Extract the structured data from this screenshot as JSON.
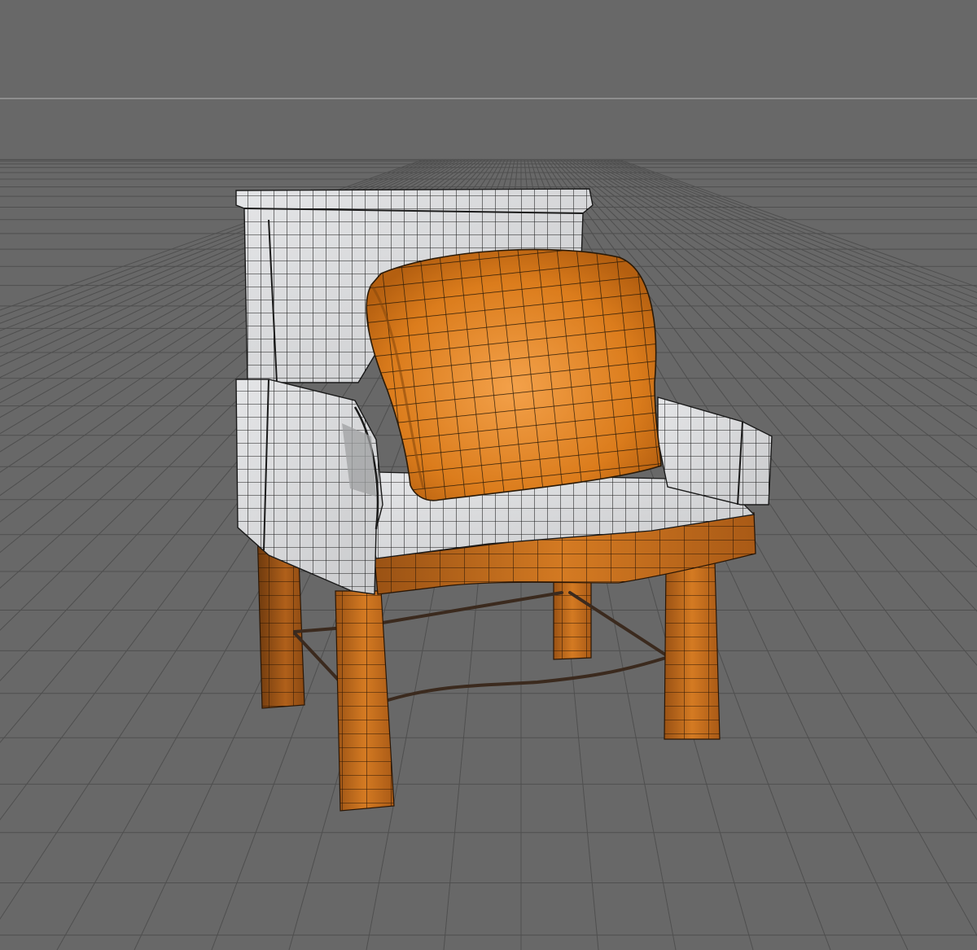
{
  "viewport": {
    "background_color": "#686868",
    "horizon_line_color": "#9a9a9a",
    "grid_line_color": "#4f4f4f"
  },
  "model": {
    "fabric_color": "#d9dadc",
    "wood_color": "#c7701d",
    "wood_dark_color": "#8e4a12",
    "pillow_color": "#e08a25",
    "wire_color": "#1c1c1c"
  }
}
